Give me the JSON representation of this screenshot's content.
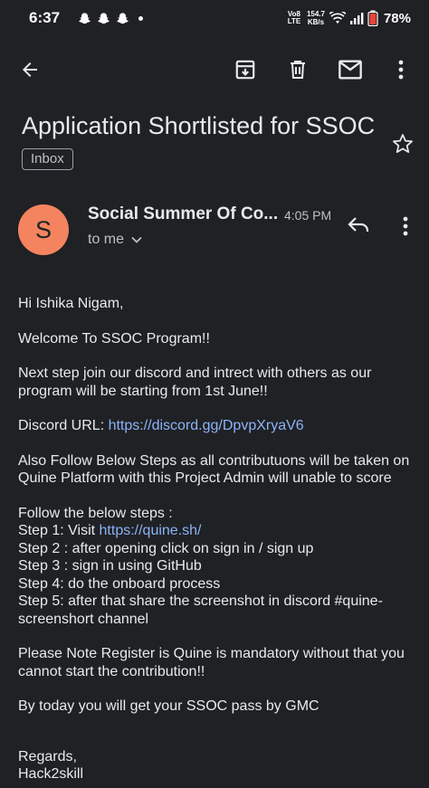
{
  "status_bar": {
    "time": "6:37",
    "volte_top": "Vo8",
    "volte_bottom": "LTE",
    "speed_top": "154.7",
    "speed_bottom": "KB/s",
    "battery": "78%"
  },
  "toolbar": {
    "back_icon": "arrow-back-icon",
    "archive_icon": "archive-icon",
    "delete_icon": "trash-icon",
    "mark_unread_icon": "mail-icon",
    "more_icon": "more-vertical-icon"
  },
  "email": {
    "subject": "Application Shortlisted for SSOC",
    "label": "Inbox",
    "avatar_letter": "S",
    "avatar_color": "#f4845f",
    "sender": "Social Summer Of Co...",
    "time": "4:05 PM",
    "recipient": "to me",
    "body": {
      "greeting": "Hi Ishika Nigam,",
      "welcome": "Welcome To SSOC Program!!",
      "next_step": "Next step join our discord and intrect with others as our program will be starting from 1st June!!",
      "discord_label": "Discord URL: ",
      "discord_url": "https://discord.gg/DpvpXryaV6",
      "follow_note": "Also Follow Below Steps as all contributuons will be taken on Quine Platform with this Project Admin will unable to score",
      "steps_heading": "Follow the below steps :",
      "step1_label": "Step 1: Visit ",
      "step1_url": "https://quine.sh/",
      "step2": "Step 2 : after opening click on sign in / sign up",
      "step3": "Step 3 : sign in using GitHub",
      "step4": "Step 4: do the onboard process",
      "step5": "Step 5: after that share the screenshot in discord #quine-screenshort channel",
      "note": "Please Note Register is Quine is mandatory without that you cannot start the contribution!!",
      "pass": "By today you will get your SSOC pass by GMC",
      "regards": "Regards,",
      "signature": "Hack2skill"
    }
  },
  "colors": {
    "background": "#202124",
    "link": "#8ab4f8",
    "text": "#e8eaed"
  }
}
